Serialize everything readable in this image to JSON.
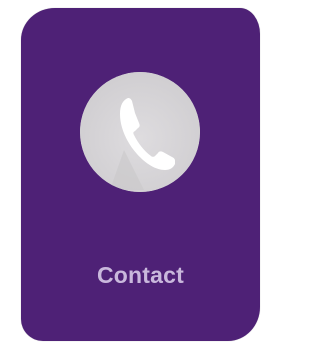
{
  "tile": {
    "label": "Contact",
    "icon": "phone-icon",
    "background_color": "#4e2176",
    "circle_color": "#d2d0d3",
    "label_color": "#c9b8dc"
  }
}
